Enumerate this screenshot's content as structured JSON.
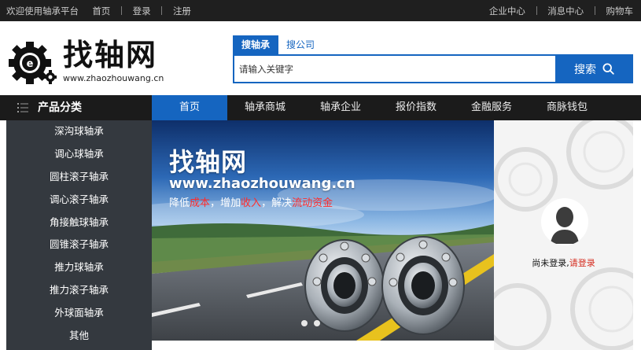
{
  "topbar": {
    "welcome": "欢迎使用轴承平台",
    "home": "首页",
    "login": "登录",
    "register": "注册",
    "enterprise_center": "企业中心",
    "message_center": "消息中心",
    "cart": "购物车"
  },
  "logo": {
    "name": "找轴网",
    "url": "www.zhaozhouwang.cn"
  },
  "search": {
    "tabs": [
      "搜轴承",
      "搜公司"
    ],
    "placeholder": "请输入关键字",
    "button": "搜索"
  },
  "nav": {
    "category_label": "产品分类",
    "items": [
      "首页",
      "轴承商城",
      "轴承企业",
      "报价指数",
      "金融服务",
      "商脉钱包"
    ]
  },
  "sidebar": {
    "items": [
      "深沟球轴承",
      "调心球轴承",
      "圆柱滚子轴承",
      "调心滚子轴承",
      "角接触球轴承",
      "圆锥滚子轴承",
      "推力球轴承",
      "推力滚子轴承",
      "外球面轴承",
      "其他"
    ]
  },
  "banner": {
    "title": "找轴网",
    "url": "www.zhaozhouwang.cn",
    "slogan": {
      "p1": "降低",
      "h1": "成本",
      "p2": "，增加",
      "h2": "收入",
      "p3": "，解决",
      "h3": "流动资金"
    },
    "slides": 2
  },
  "user": {
    "status": "尚未登录,",
    "login_link": "请登录"
  },
  "colors": {
    "brand_blue": "#1565c0",
    "topbar_bg": "#1f1f1f",
    "sidebar_bg": "#34393f",
    "highlight_red": "#ff2b2b"
  }
}
